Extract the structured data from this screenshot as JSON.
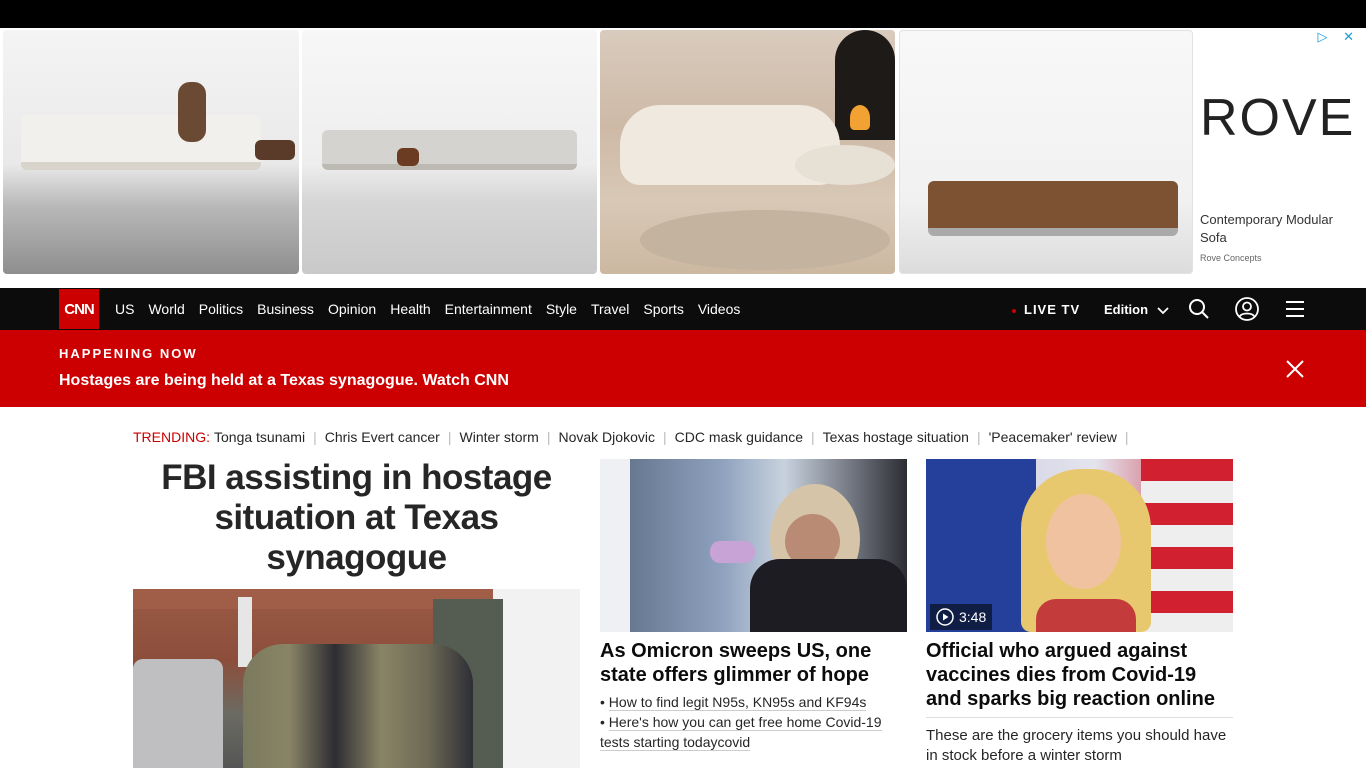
{
  "ad": {
    "brand_logo": "ROVE",
    "title": "Contemporary Modular Sofa",
    "advertiser": "Rove Concepts",
    "controls": "▷ ✕"
  },
  "nav": {
    "logo": "CNN",
    "links": [
      "US",
      "World",
      "Politics",
      "Business",
      "Opinion",
      "Health",
      "Entertainment",
      "Style",
      "Travel",
      "Sports",
      "Videos"
    ],
    "live_tv": "LIVE TV",
    "edition": "Edition",
    "icons": [
      "search-icon",
      "account-icon",
      "menu-icon"
    ]
  },
  "breaking": {
    "label": "HAPPENING NOW",
    "text": "Hostages are being held at a Texas synagogue. Watch CNN"
  },
  "trending": {
    "label": "TRENDING:",
    "items": [
      "Tonga tsunami",
      "Chris Evert cancer",
      "Winter storm",
      "Novak Djokovic",
      "CDC mask guidance",
      "Texas hostage situation",
      "'Peacemaker' review"
    ]
  },
  "lead": {
    "headline": "FBI assisting in hostage situation at Texas synagogue"
  },
  "cards": [
    {
      "headline": "As Omicron sweeps US, one state offers glimmer of hope",
      "related": [
        "How to find legit N95s, KN95s and KF94s",
        "Here's how you can get free home Covid-19 tests starting todaycovid"
      ]
    },
    {
      "headline": "Official who argued against vaccines dies from Covid-19 and sparks big reaction online",
      "duration": "3:48",
      "sub": "These are the grocery items you should have in stock before a winter storm"
    }
  ],
  "colors": {
    "brand_red": "#cc0000",
    "nav_bg": "#0c0c0c"
  }
}
